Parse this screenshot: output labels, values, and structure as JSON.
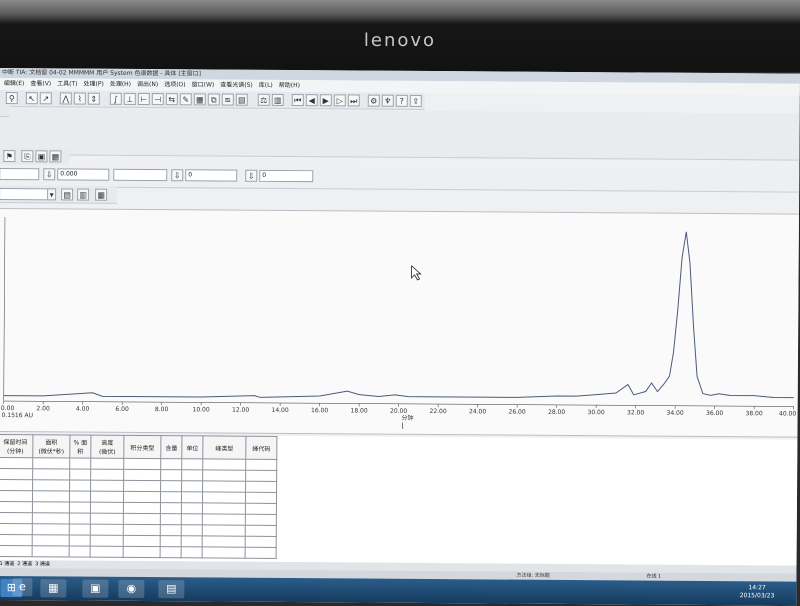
{
  "monitor": {
    "brand": "lenovo"
  },
  "window": {
    "title": "中断 TIA: 文档窗 04-02 MMMMM 用户 System 色谱数据 - 具体 [主窗口]"
  },
  "menu": [
    "编辑(E)",
    "查看(V)",
    "工具(T)",
    "处理(P)",
    "处理(H)",
    "调出(N)",
    "选项(O)",
    "窗口(W)",
    "查看光谱(S)",
    "库(L)",
    "帮助(H)"
  ],
  "fields": {
    "value1": "0.000",
    "value2": "0",
    "value3": "0"
  },
  "chart": {
    "y_readout": "0.1516 AU",
    "x_unit": "分钟"
  },
  "chart_data": {
    "type": "line",
    "xlabel": "分钟",
    "ylabel": "",
    "xlim": [
      0,
      40
    ],
    "x_ticks": [
      "0.00",
      "2.00",
      "4.00",
      "6.00",
      "8.00",
      "10.00",
      "12.00",
      "14.00",
      "16.00",
      "18.00",
      "20.00",
      "22.00",
      "24.00",
      "26.00",
      "28.00",
      "30.00",
      "32.00",
      "34.00",
      "36.00",
      "38.00",
      "40.00"
    ],
    "ylim": [
      0,
      1
    ],
    "series": [
      {
        "x": [
          0,
          2,
          4.5,
          5,
          10,
          12.7,
          13,
          16,
          17.4,
          18,
          19,
          19.8,
          20.5,
          22,
          24,
          26,
          28,
          29,
          30,
          31,
          31.6,
          31.9,
          32.2,
          32.5,
          32.8,
          33.1,
          33.4,
          33.7,
          33.9,
          34.1,
          34.3,
          34.5,
          34.7,
          34.9,
          35.1,
          35.4,
          35.8,
          36.2,
          36.8,
          38,
          39,
          40
        ],
        "y": [
          0.02,
          0.02,
          0.04,
          0.02,
          0.02,
          0.03,
          0.02,
          0.03,
          0.06,
          0.04,
          0.03,
          0.04,
          0.03,
          0.03,
          0.03,
          0.03,
          0.04,
          0.04,
          0.05,
          0.06,
          0.11,
          0.05,
          0.06,
          0.07,
          0.12,
          0.07,
          0.11,
          0.16,
          0.3,
          0.55,
          0.85,
          1.0,
          0.82,
          0.45,
          0.16,
          0.06,
          0.05,
          0.06,
          0.05,
          0.05,
          0.04,
          0.04
        ]
      }
    ]
  },
  "results_table": {
    "headers": [
      "保留时间\n(分钟)",
      "面积\n(微伏*秒)",
      "% 面积",
      "高度\n(微伏)",
      "积分类型",
      "含量",
      "单位",
      "峰类型",
      "峰代码"
    ],
    "rows": 9
  },
  "tabs": [
    "1 通道",
    "2 通道",
    "3 通道"
  ],
  "status": {
    "left": "",
    "mid": "方法组: 无标题",
    "right": "在线 1"
  },
  "clock": {
    "time": "14:27",
    "date": "2015/03/23"
  }
}
